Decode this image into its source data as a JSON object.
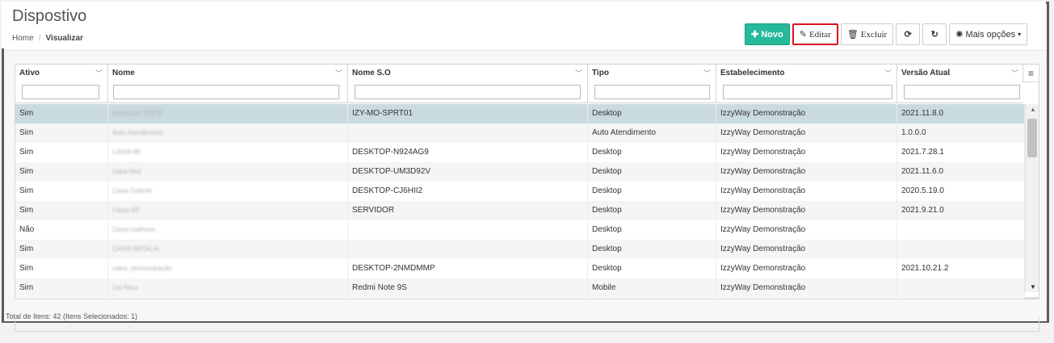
{
  "header": {
    "title": "Dispostivo",
    "breadcrumb": {
      "home": "Home",
      "separator": "/",
      "current": "Visualizar"
    }
  },
  "toolbar": {
    "novo_label": "Novo",
    "editar_label": "Editar",
    "excluir_label": "Excluir",
    "mais_opcoes_label": "Mais opções",
    "icons": {
      "novo": "plus-icon",
      "editar": "pencil-icon",
      "excluir": "trash-icon",
      "sync": "sync-icon",
      "refresh": "refresh-icon",
      "mais": "gear-icon",
      "caret": "caret-down-icon"
    }
  },
  "grid": {
    "columns": [
      {
        "label": "Ativo"
      },
      {
        "label": "Nome"
      },
      {
        "label": "Nome S.O"
      },
      {
        "label": "Tipo"
      },
      {
        "label": "Estabelecimento"
      },
      {
        "label": "Versão Atual"
      }
    ],
    "rows": [
      {
        "ativo": "Sim",
        "nome": "ANAGLIA TESTE",
        "nome_so": "IZY-MO-SPRT01",
        "tipo": "Desktop",
        "estabelecimento": "IzzyWay Demonstração",
        "versao": "2021.11.8.0",
        "selected": true
      },
      {
        "ativo": "Sim",
        "nome": "Auto Atendimento",
        "nome_so": "",
        "tipo": "Auto Atendimento",
        "estabelecimento": "IzzyWay Demonstração",
        "versao": "1.0.0.0",
        "selected": false
      },
      {
        "ativo": "Sim",
        "nome": "CAIXA 88",
        "nome_so": "DESKTOP-N924AG9",
        "tipo": "Desktop",
        "estabelecimento": "IzzyWay Demonstração",
        "versao": "2021.7.28.1",
        "selected": false
      },
      {
        "ativo": "Sim",
        "nome": "caixa Ned",
        "nome_so": "DESKTOP-UM3D92V",
        "tipo": "Desktop",
        "estabelecimento": "IzzyWay Demonstração",
        "versao": "2021.11.6.0",
        "selected": false
      },
      {
        "ativo": "Sim",
        "nome": "Caixa Gabriel",
        "nome_so": "DESKTOP-CJ6HII2",
        "tipo": "Desktop",
        "estabelecimento": "IzzyWay Demonstração",
        "versao": "2020.5.19.0",
        "selected": false
      },
      {
        "ativo": "Sim",
        "nome": "Caixa SS",
        "nome_so": "SERVIDOR",
        "tipo": "Desktop",
        "estabelecimento": "IzzyWay Demonstração",
        "versao": "2021.9.21.0",
        "selected": false
      },
      {
        "ativo": "Não",
        "nome": "Caixa matheus",
        "nome_so": "",
        "tipo": "Desktop",
        "estabelecimento": "IzzyWay Demonstração",
        "versao": "",
        "selected": false
      },
      {
        "ativo": "Sim",
        "nome": "CAIXA NATALIA",
        "nome_so": "",
        "tipo": "Desktop",
        "estabelecimento": "IzzyWay Demonstração",
        "versao": "",
        "selected": false
      },
      {
        "ativo": "Sim",
        "nome": "caixa_demonstração",
        "nome_so": "DESKTOP-2NMDMMP",
        "tipo": "Desktop",
        "estabelecimento": "IzzyWay Demonstração",
        "versao": "2021.10.21.2",
        "selected": false
      },
      {
        "ativo": "Sim",
        "nome": "Cel Necs",
        "nome_so": "Redmi Note 9S",
        "tipo": "Mobile",
        "estabelecimento": "IzzyWay Demonstração",
        "versao": "",
        "selected": false
      }
    ]
  },
  "footer": {
    "total_text": "Total de Itens: 42 (Itens Selecionados: 1)"
  },
  "colors": {
    "primary": "#26b99a",
    "highlight": "#d9121e",
    "selected_row": "#c9dbe1"
  }
}
